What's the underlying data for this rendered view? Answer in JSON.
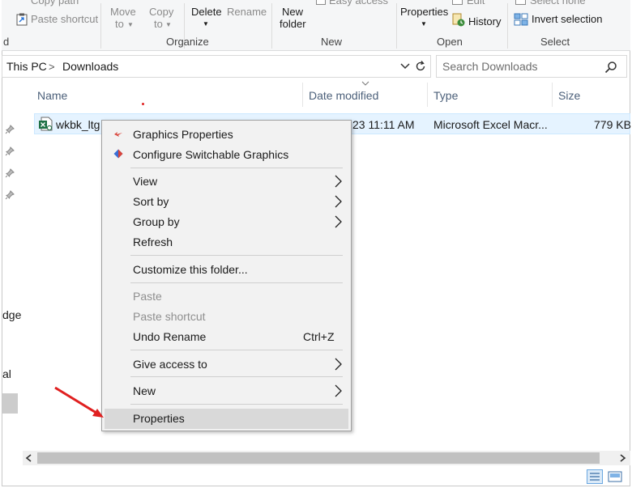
{
  "ribbon": {
    "copy_path": "Copy path",
    "paste_shortcut": "Paste shortcut",
    "move_to": "Move",
    "move_to_sub": "to",
    "copy_to": "Copy",
    "copy_to_sub": "to",
    "delete": "Delete",
    "rename": "Rename",
    "new_folder_line1": "New",
    "new_folder_line2": "folder",
    "easy_access": "Easy access",
    "properties": "Properties",
    "edit": "Edit",
    "history": "History",
    "select_none": "Select none",
    "invert_selection": "Invert selection",
    "group_clipboard_tail": "d",
    "group_organize": "Organize",
    "group_new": "New",
    "group_open": "Open",
    "group_select": "Select"
  },
  "address": {
    "root": "This PC",
    "separator": ">",
    "folder": "Downloads"
  },
  "search": {
    "placeholder": "Search Downloads"
  },
  "columns": {
    "name": "Name",
    "date_modified": "Date modified",
    "type": "Type",
    "size": "Size"
  },
  "file": {
    "name": "wkbk_ltg",
    "date": "23 11:11 AM",
    "type": "Microsoft Excel Macr...",
    "size": "779 KB"
  },
  "nav": {
    "item_edge": "dge",
    "item_al": "al"
  },
  "menu": {
    "graphics_properties": "Graphics Properties",
    "configure_switchable": "Configure Switchable Graphics",
    "view": "View",
    "sort_by": "Sort by",
    "group_by": "Group by",
    "refresh": "Refresh",
    "customize": "Customize this folder...",
    "paste": "Paste",
    "paste_shortcut": "Paste shortcut",
    "undo_rename": "Undo Rename",
    "undo_shortcut": "Ctrl+Z",
    "give_access": "Give access to",
    "new": "New",
    "properties": "Properties"
  },
  "colors": {
    "selection_fill": "#e5f3ff",
    "selection_border": "#cce8ff",
    "menu_bg": "#f2f2f2",
    "menu_highlight": "#d9d9d9",
    "annotation_arrow": "#e02020",
    "header_text": "#4c607a"
  }
}
